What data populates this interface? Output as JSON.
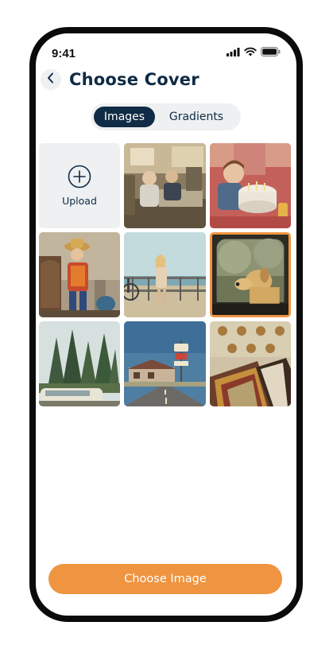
{
  "status_bar": {
    "time": "9:41",
    "icons": [
      "cellular-signal-icon",
      "wifi-icon",
      "battery-icon"
    ]
  },
  "header": {
    "back_icon": "chevron-left-icon",
    "title": "Choose Cover"
  },
  "tabs": {
    "items": [
      {
        "label": "Images",
        "active": true
      },
      {
        "label": "Gradients",
        "active": false
      }
    ]
  },
  "grid": {
    "upload": {
      "icon": "plus-circle-icon",
      "label": "Upload"
    },
    "images": [
      {
        "name": "image-rv-interior-kids",
        "selected": false
      },
      {
        "name": "image-boy-birthday-cake",
        "selected": false
      },
      {
        "name": "image-boy-cowboy-costume",
        "selected": false
      },
      {
        "name": "image-girl-boardwalk",
        "selected": false
      },
      {
        "name": "image-dog-car-window",
        "selected": true
      },
      {
        "name": "image-pine-trees-van",
        "selected": false
      },
      {
        "name": "image-route-66-motel-sign",
        "selected": false
      },
      {
        "name": "image-vinyl-records",
        "selected": false
      }
    ]
  },
  "cta": {
    "label": "Choose Image"
  },
  "colors": {
    "accent": "#ef9440",
    "primary": "#0f2b45",
    "surface": "#eef0f2",
    "frame": "#0b0b0b"
  }
}
